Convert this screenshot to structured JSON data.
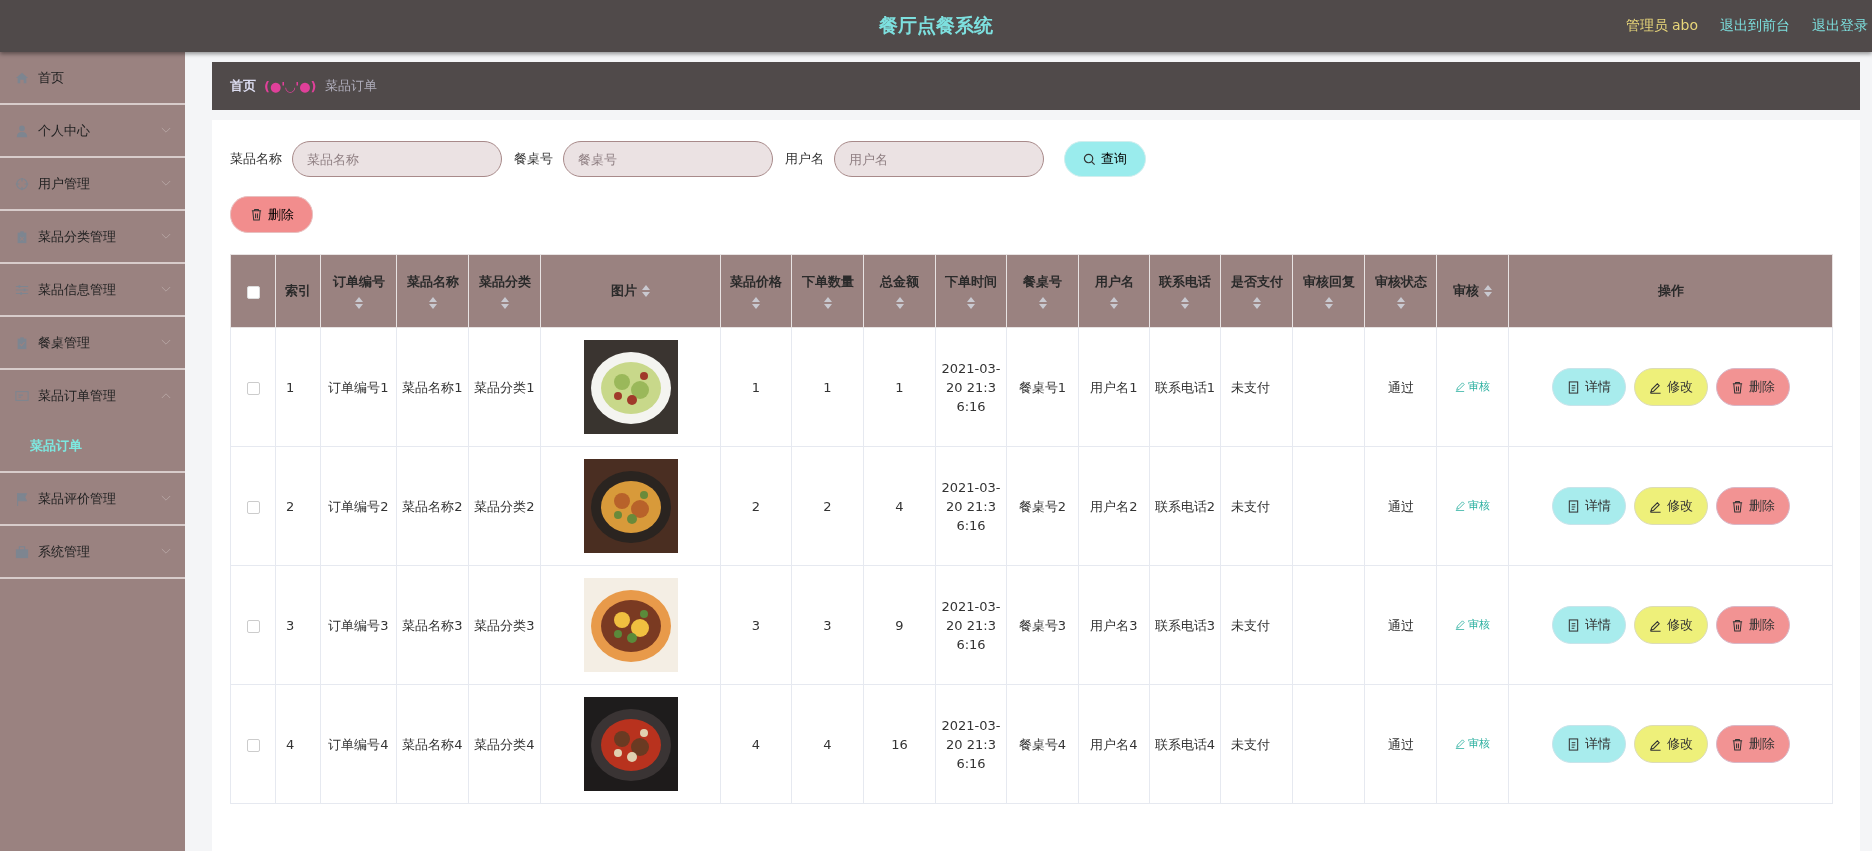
{
  "header": {
    "title": "餐厅点餐系统",
    "user": "管理员 abo",
    "links": [
      "退出到前台",
      "退出登录"
    ]
  },
  "sidebar": {
    "items": [
      {
        "label": "首页",
        "kind": "link"
      },
      {
        "label": "个人中心",
        "kind": "group",
        "expanded": false
      },
      {
        "label": "用户管理",
        "kind": "group",
        "expanded": false
      },
      {
        "label": "菜品分类管理",
        "kind": "group",
        "expanded": false
      },
      {
        "label": "菜品信息管理",
        "kind": "group",
        "expanded": false
      },
      {
        "label": "餐桌管理",
        "kind": "group",
        "expanded": false
      },
      {
        "label": "菜品订单管理",
        "kind": "group",
        "expanded": true,
        "children": [
          {
            "label": "菜品订单",
            "selected": true
          }
        ]
      },
      {
        "label": "菜品评价管理",
        "kind": "group",
        "expanded": false
      },
      {
        "label": "系统管理",
        "kind": "group",
        "expanded": false
      }
    ]
  },
  "breadcrumb": {
    "home": "首页",
    "separator": "(●'◡'●)",
    "current": "菜品订单"
  },
  "search": {
    "fields": [
      {
        "label": "菜品名称",
        "placeholder": "菜品名称"
      },
      {
        "label": "餐桌号",
        "placeholder": "餐桌号"
      },
      {
        "label": "用户名",
        "placeholder": "用户名"
      }
    ],
    "button": "查询"
  },
  "delete_button": "删除",
  "table": {
    "select_all": {
      "checked": false
    },
    "columns": [
      {
        "label": "索引",
        "kind": "plain"
      },
      {
        "label": "订单编号",
        "kind": "stacked"
      },
      {
        "label": "菜品名称",
        "kind": "stacked"
      },
      {
        "label": "菜品分类",
        "kind": "stacked"
      },
      {
        "label": "图片",
        "kind": "inline"
      },
      {
        "label": "菜品价格",
        "kind": "stacked"
      },
      {
        "label": "下单数量",
        "kind": "stacked"
      },
      {
        "label": "总金额",
        "kind": "stacked"
      },
      {
        "label": "下单时间",
        "kind": "stacked"
      },
      {
        "label": "餐桌号",
        "kind": "stacked"
      },
      {
        "label": "用户名",
        "kind": "stacked"
      },
      {
        "label": "联系电话",
        "kind": "stacked"
      },
      {
        "label": "是否支付",
        "kind": "stacked"
      },
      {
        "label": "审核回复",
        "kind": "stacked"
      },
      {
        "label": "审核状态",
        "kind": "stacked"
      },
      {
        "label": "审核",
        "kind": "inline"
      },
      {
        "label": "操作",
        "kind": "plain"
      }
    ],
    "rows": [
      {
        "checked": false,
        "cells": [
          "1",
          "订单编号1",
          "菜品名称1",
          "菜品分类1",
          {
            "kind": "picture"
          },
          "1",
          "1",
          "1",
          "2021-03-20 21:36:16",
          "餐桌号1",
          "用户名1",
          "联系电话1",
          "未支付",
          "",
          "通过"
        ],
        "review": "审核",
        "actions": [
          "详情",
          "修改",
          "删除"
        ]
      },
      {
        "checked": false,
        "cells": [
          "2",
          "订单编号2",
          "菜品名称2",
          "菜品分类2",
          {
            "kind": "picture"
          },
          "2",
          "2",
          "4",
          "2021-03-20 21:36:16",
          "餐桌号2",
          "用户名2",
          "联系电话2",
          "未支付",
          "",
          "通过"
        ],
        "review": "审核",
        "actions": [
          "详情",
          "修改",
          "删除"
        ]
      },
      {
        "checked": false,
        "cells": [
          "3",
          "订单编号3",
          "菜品名称3",
          "菜品分类3",
          {
            "kind": "picture"
          },
          "3",
          "3",
          "9",
          "2021-03-20 21:36:16",
          "餐桌号3",
          "用户名3",
          "联系电话3",
          "未支付",
          "",
          "通过"
        ],
        "review": "审核",
        "actions": [
          "详情",
          "修改",
          "删除"
        ]
      },
      {
        "checked": false,
        "cells": [
          "4",
          "订单编号4",
          "菜品名称4",
          "菜品分类4",
          {
            "kind": "picture"
          },
          "4",
          "4",
          "16",
          "2021-03-20 21:36:16",
          "餐桌号4",
          "用户名4",
          "联系电话4",
          "未支付",
          "",
          "通过"
        ],
        "review": "审核",
        "actions": [
          "详情",
          "修改",
          "删除"
        ]
      }
    ]
  }
}
